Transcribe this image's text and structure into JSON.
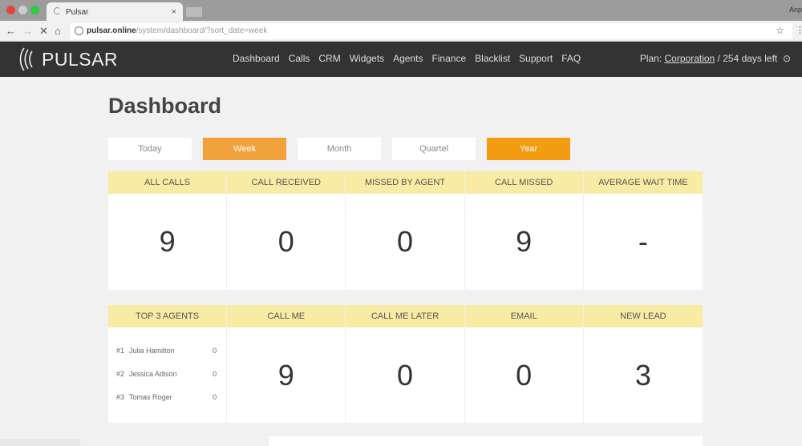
{
  "browser": {
    "tab_title": "Pulsar",
    "user": "Anp",
    "url_host": "pulsar.online",
    "url_path": "/system/dashboard/?sort_date=week"
  },
  "app": {
    "logo": "PULSAR",
    "menu": [
      "Dashboard",
      "Calls",
      "CRM",
      "Widgets",
      "Agents",
      "Finance",
      "Blacklist",
      "Support",
      "FAQ"
    ],
    "plan_prefix": "Plan: ",
    "plan_name": "Corporation",
    "plan_suffix": " / 254 days left"
  },
  "page": {
    "title": "Dashboard",
    "periods": [
      "Today",
      "Week",
      "Month",
      "Quartel",
      "Year"
    ],
    "stats": [
      {
        "label": "ALL CALLS",
        "value": "9"
      },
      {
        "label": "CALL RECEIVED",
        "value": "0"
      },
      {
        "label": "MISSED BY AGENT",
        "value": "0"
      },
      {
        "label": "CALL MISSED",
        "value": "9"
      },
      {
        "label": "AVERAGE WAIT TIME",
        "value": "-"
      }
    ],
    "top_agents_label": "TOP 3 AGENTS",
    "agents": [
      {
        "rank": "#1",
        "name": "Julia Hamilton",
        "count": "0"
      },
      {
        "rank": "#2",
        "name": "Jessica Adison",
        "count": "0"
      },
      {
        "rank": "#3",
        "name": "Tomas Roger",
        "count": "0"
      }
    ],
    "stats2": [
      {
        "label": "CALL ME",
        "value": "9"
      },
      {
        "label": "CALL ME LATER",
        "value": "0"
      },
      {
        "label": "EMAIL",
        "value": "0"
      },
      {
        "label": "NEW LEAD",
        "value": "3"
      }
    ]
  },
  "colors": {
    "accent": "#f2a23a",
    "header_yellow": "#f8eca4",
    "appbar": "#333333"
  }
}
